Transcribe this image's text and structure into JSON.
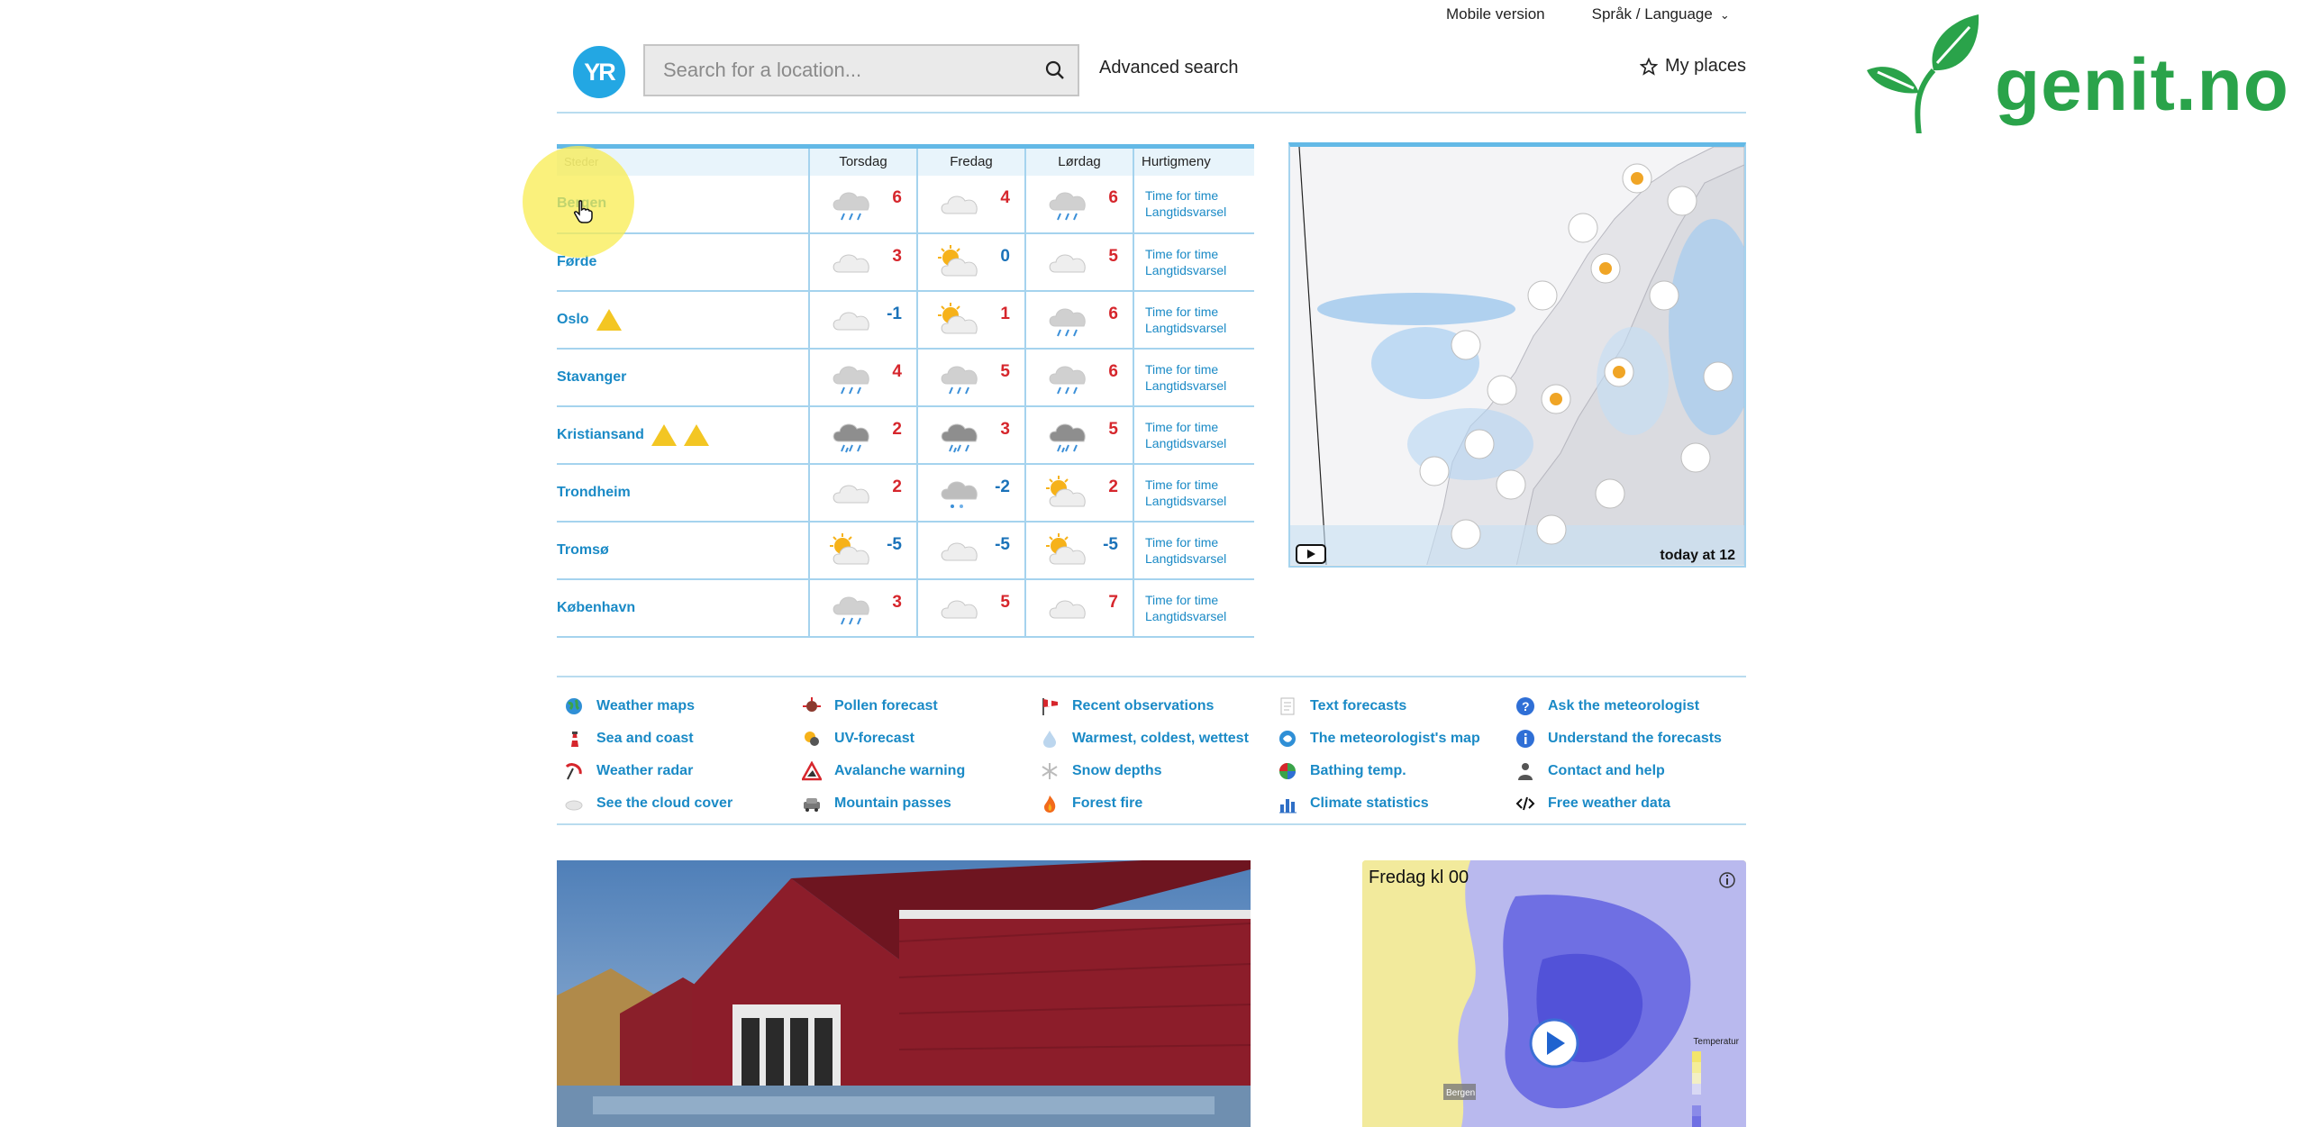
{
  "topnav": {
    "mobile": "Mobile version",
    "language": "Språk / Language"
  },
  "header": {
    "logo": "YR",
    "search_placeholder": "Search for a location...",
    "advanced_search": "Advanced search",
    "my_places": "My places"
  },
  "brand": {
    "text": "genit.no"
  },
  "table": {
    "headers": {
      "places": "Steder",
      "d1": "Torsdag",
      "d2": "Fredag",
      "d3": "Lørdag",
      "quick": "Hurtigmeny"
    },
    "quick1": "Time for time",
    "quick2": "Langtidsvarsel",
    "rows": [
      {
        "city": "Bergen",
        "warnings": 0,
        "t1": "6",
        "t2": "4",
        "t3": "6",
        "w1": "rain",
        "w2": "cloud",
        "w3": "rain"
      },
      {
        "city": "Førde",
        "warnings": 0,
        "t1": "3",
        "t2": "0",
        "t3": "5",
        "w1": "cloud",
        "w2": "sun-cloud",
        "w3": "cloud"
      },
      {
        "city": "Oslo",
        "warnings": 1,
        "t1": "-1",
        "t2": "1",
        "t3": "6",
        "w1": "cloud",
        "w2": "sun-cloud",
        "w3": "rain"
      },
      {
        "city": "Stavanger",
        "warnings": 0,
        "t1": "4",
        "t2": "5",
        "t3": "6",
        "w1": "rain",
        "w2": "rain",
        "w3": "rain"
      },
      {
        "city": "Kristiansand",
        "warnings": 2,
        "t1": "2",
        "t2": "3",
        "t3": "5",
        "w1": "heavy",
        "w2": "heavy",
        "w3": "heavy"
      },
      {
        "city": "Trondheim",
        "warnings": 0,
        "t1": "2",
        "t2": "-2",
        "t3": "2",
        "w1": "cloud",
        "w2": "sleet",
        "w3": "sun-cloud"
      },
      {
        "city": "Tromsø",
        "warnings": 0,
        "t1": "-5",
        "t2": "-5",
        "t3": "-5",
        "w1": "sun-cloud",
        "w2": "cloud",
        "w3": "sun-cloud"
      },
      {
        "city": "København",
        "warnings": 0,
        "t1": "3",
        "t2": "5",
        "t3": "7",
        "w1": "rain",
        "w2": "cloud",
        "w3": "cloud"
      }
    ]
  },
  "map": {
    "time_label": "today at 12"
  },
  "links": [
    {
      "label": "Weather maps",
      "icon": "globe-icon"
    },
    {
      "label": "Sea and coast",
      "icon": "lighthouse-icon"
    },
    {
      "label": "Weather radar",
      "icon": "radar-icon"
    },
    {
      "label": "See the cloud cover",
      "icon": "cloud-icon"
    },
    {
      "label": "Pollen forecast",
      "icon": "pollen-icon"
    },
    {
      "label": "UV-forecast",
      "icon": "uv-icon"
    },
    {
      "label": "Avalanche warning",
      "icon": "avalanche-icon"
    },
    {
      "label": "Mountain passes",
      "icon": "car-icon"
    },
    {
      "label": "Recent observations",
      "icon": "windsock-icon"
    },
    {
      "label": "Warmest, coldest, wettest",
      "icon": "drop-icon"
    },
    {
      "label": "Snow depths",
      "icon": "snowflake-icon"
    },
    {
      "label": "Forest fire",
      "icon": "fire-icon"
    },
    {
      "label": "Text forecasts",
      "icon": "document-icon"
    },
    {
      "label": "The meteorologist's map",
      "icon": "map-icon"
    },
    {
      "label": "Bathing temp.",
      "icon": "ball-icon"
    },
    {
      "label": "Climate statistics",
      "icon": "bar-chart-icon"
    },
    {
      "label": "Ask the meteorologist",
      "icon": "question-icon"
    },
    {
      "label": "Understand the forecasts",
      "icon": "info-icon"
    },
    {
      "label": "Contact and help",
      "icon": "person-icon"
    },
    {
      "label": "Free weather data",
      "icon": "code-icon"
    }
  ],
  "tempmap": {
    "title": "Fredag kl 00",
    "legend_title": "Temperatur",
    "place": "Bergen"
  },
  "colors": {
    "accent": "#1a8ac6",
    "warm": "#d6262c",
    "cold": "#1a72b9",
    "brand": "#2aa34a",
    "line": "#a5d3ee"
  }
}
